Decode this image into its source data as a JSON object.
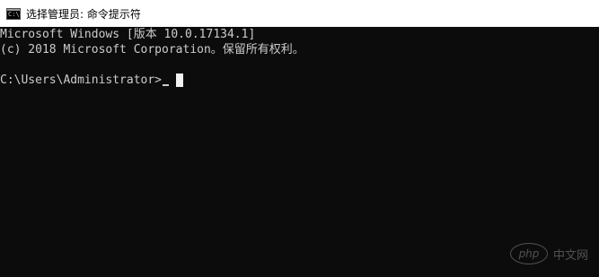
{
  "window": {
    "title": "选择管理员: 命令提示符",
    "icon": "cmd-icon"
  },
  "console": {
    "lines": [
      "Microsoft Windows [版本 10.0.17134.1]",
      "(c) 2018 Microsoft Corporation。保留所有权利。"
    ],
    "prompt": "C:\\Users\\Administrator>",
    "text_color": "#cccccc",
    "background_color": "#0c0c0c"
  },
  "watermark": {
    "logo_text": "php",
    "text": "中文网"
  }
}
